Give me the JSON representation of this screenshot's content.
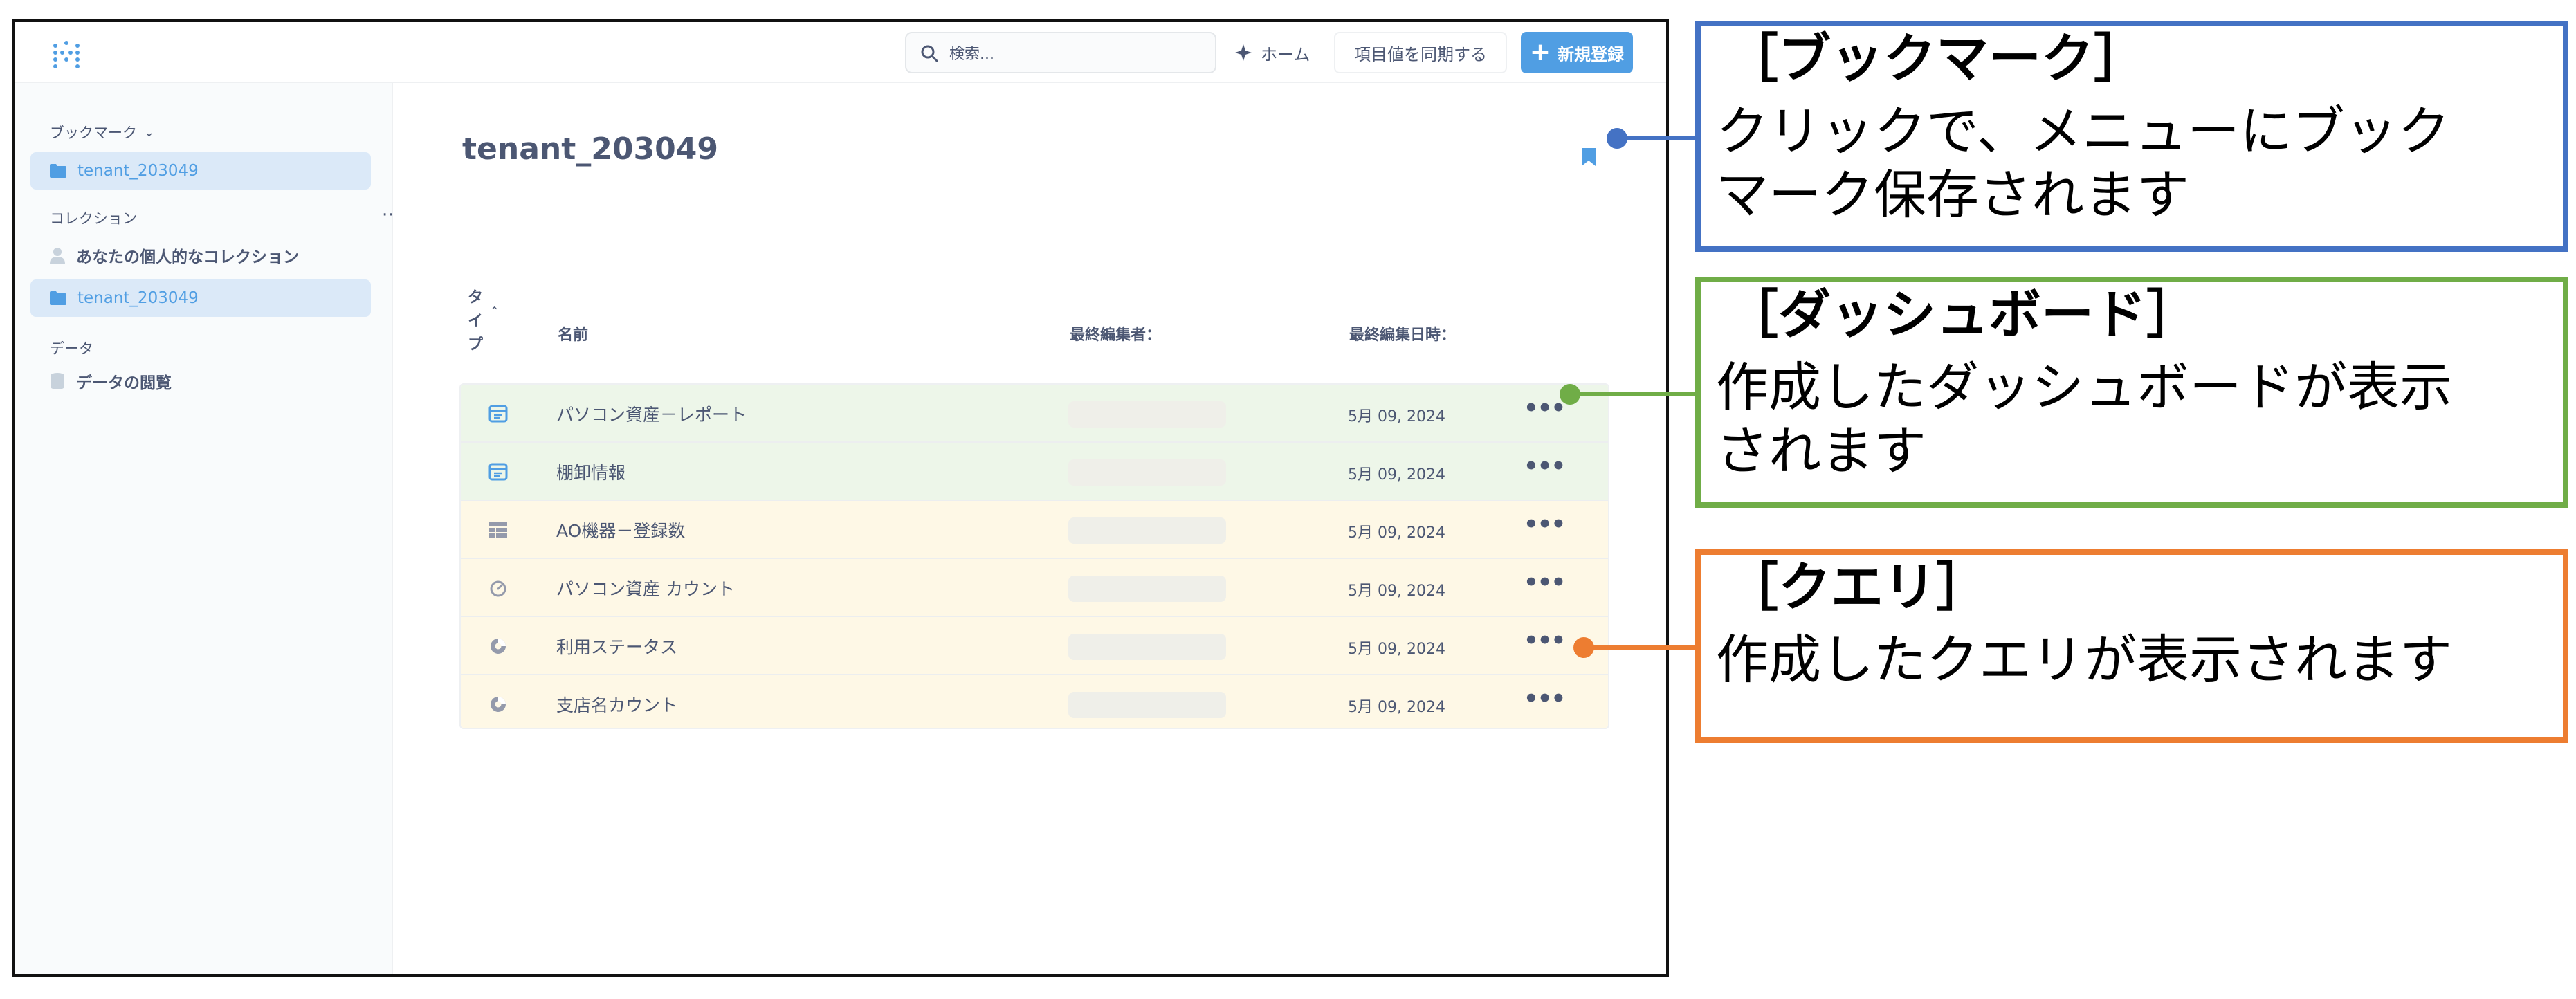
{
  "header": {
    "search_placeholder": "検索...",
    "home_label": "ホーム",
    "sync_label": "項目値を同期する",
    "new_label": "新規登録"
  },
  "sidebar": {
    "bookmarks_heading": "ブックマーク",
    "bookmark_item": "tenant_203049",
    "collections_heading": "コレクション",
    "personal_collection": "あなたの個人的なコレクション",
    "collection_item": "tenant_203049",
    "data_heading": "データ",
    "browse_data": "データの閲覧"
  },
  "main": {
    "title": "tenant_203049",
    "columns": {
      "type": "タ\nイ\nプ",
      "name": "名前",
      "editor": "最終編集者：",
      "edited_at": "最終編集日時："
    },
    "rows": [
      {
        "icon": "dashboard-icon",
        "name": "パソコン資産－レポート",
        "date": "5月 09, 2024",
        "kind": "dashboard"
      },
      {
        "icon": "dashboard-icon",
        "name": "棚卸情報",
        "date": "5月 09, 2024",
        "kind": "dashboard"
      },
      {
        "icon": "table-icon",
        "name": "AO機器－登録数",
        "date": "5月 09, 2024",
        "kind": "query"
      },
      {
        "icon": "gauge-icon",
        "name": "パソコン資産 カウント",
        "date": "5月 09, 2024",
        "kind": "query"
      },
      {
        "icon": "pie-icon",
        "name": "利用ステータス",
        "date": "5月 09, 2024",
        "kind": "query"
      },
      {
        "icon": "pie-icon",
        "name": "支店名カウント",
        "date": "5月 09, 2024",
        "kind": "query"
      }
    ],
    "more_label": "•••"
  },
  "callouts": {
    "bookmark": {
      "title": "［ブックマーク］",
      "line1": "クリックで、メニューにブック",
      "line2": "マーク保存されます",
      "color": "#4472c4"
    },
    "dashboard": {
      "title": "［ダッシュボード］",
      "line1": "作成したダッシュボードが表示",
      "line2": "されます",
      "color": "#70ad47"
    },
    "query": {
      "title": "［クエリ］",
      "line1": "作成したクエリが表示されます",
      "color": "#ed7d31"
    }
  },
  "colors": {
    "accent": "#509ee3",
    "dashboard_row_bg": "#edf6e9",
    "query_row_bg": "#fef8e6"
  }
}
